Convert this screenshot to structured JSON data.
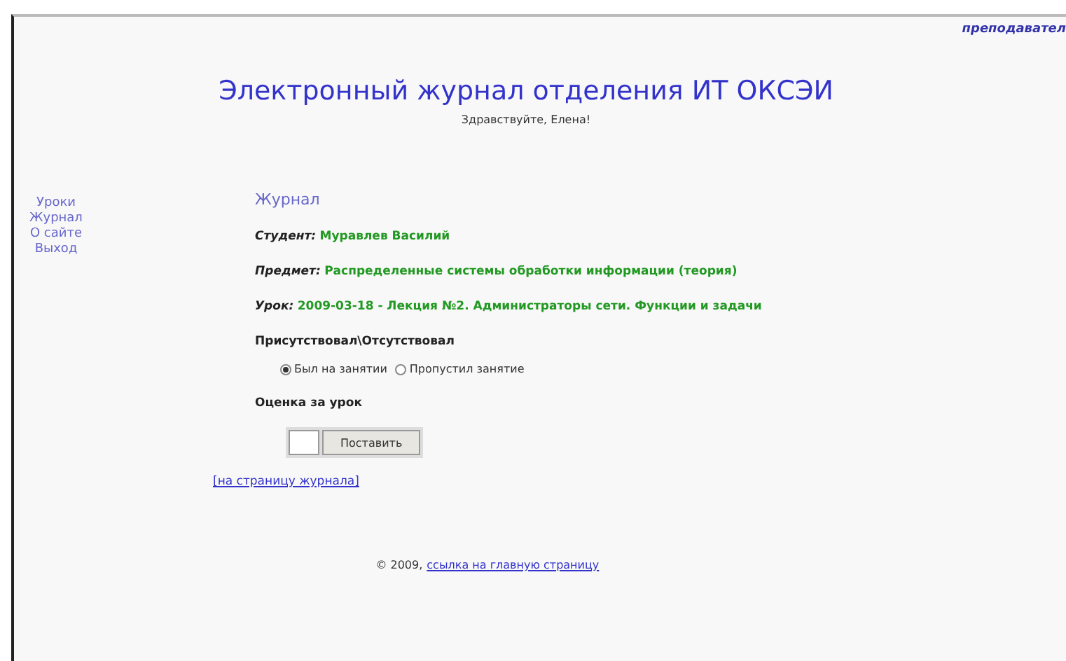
{
  "top_link": "преподавател",
  "header": {
    "title": "Электронный журнал отделения ИТ ОКСЭИ",
    "greeting": "Здравствуйте, Елена!"
  },
  "sidebar": {
    "items": [
      {
        "label": "Уроки"
      },
      {
        "label": "Журнал"
      },
      {
        "label": "О сайте"
      },
      {
        "label": "Выход"
      }
    ]
  },
  "content": {
    "heading": "Журнал",
    "fields": [
      {
        "label": "Студент:",
        "value": "Муравлев Василий"
      },
      {
        "label": "Предмет:",
        "value": "Распределенные системы обработки информации (теория)"
      },
      {
        "label": "Урок:",
        "value": "2009-03-18 - Лекция №2. Администраторы сети. Функции и задачи"
      }
    ],
    "attendance_label": "Присутствовал\\Отсутствовал",
    "attendance": [
      {
        "label": "Был на занятии",
        "selected": true
      },
      {
        "label": "Пропустил занятие",
        "selected": false
      }
    ],
    "grade_label": "Оценка за урок",
    "grade_button": "Поставить",
    "back_link": "[на страницу журнала]"
  },
  "footer": {
    "copyright": "© 2009,",
    "link": "ссылка на главную страницу"
  }
}
